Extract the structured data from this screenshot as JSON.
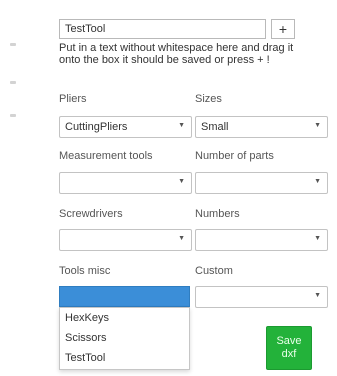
{
  "tool_entry": {
    "value": "TestTool",
    "add_label": "+",
    "hint": "Put in a text without whitespace here and drag it onto the box it should be saved or press + !"
  },
  "groups": [
    {
      "label": "Pliers",
      "selected": "CuttingPliers"
    },
    {
      "label": "Sizes",
      "selected": "Small"
    },
    {
      "label": "Measurement tools",
      "selected": ""
    },
    {
      "label": "Number of parts",
      "selected": ""
    },
    {
      "label": "Screwdrivers",
      "selected": ""
    },
    {
      "label": "Numbers",
      "selected": ""
    },
    {
      "label": "Tools misc",
      "selected": ""
    },
    {
      "label": "Custom",
      "selected": ""
    }
  ],
  "tools_misc_options": [
    "HexKeys",
    "Scissors",
    "TestTool"
  ],
  "save_button": {
    "line1": "Save",
    "line2": "dxf"
  },
  "icons": {
    "dropdown_arrow": "chevron-down-icon"
  },
  "colors": {
    "open_select": "#3b8ed8",
    "save_button": "#23b23a"
  }
}
